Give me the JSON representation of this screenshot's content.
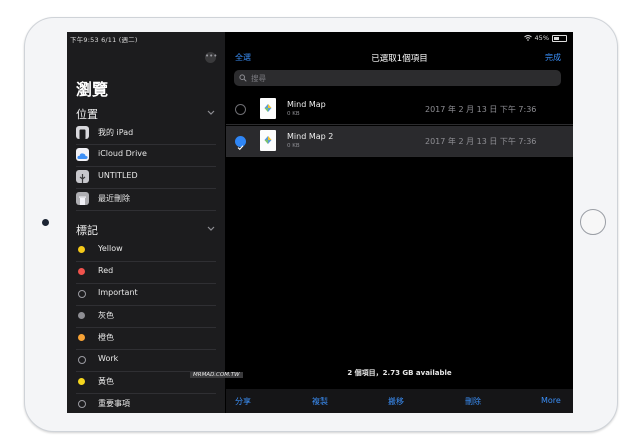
{
  "status_bar": {
    "time_date": "下午9:53  6/11 (週二)",
    "battery": "45%"
  },
  "sidebar": {
    "title": "瀏覽",
    "locations_header": "位置",
    "locations": [
      {
        "label": "我的 iPad",
        "icon": "ipad-icon"
      },
      {
        "label": "iCloud Drive",
        "icon": "icloud-icon"
      },
      {
        "label": "UNTITLED",
        "icon": "usb-drive-icon"
      },
      {
        "label": "最近刪除",
        "icon": "trash-icon"
      }
    ],
    "tags_header": "標記",
    "tags": [
      {
        "label": "Yellow",
        "color": "#f5c919"
      },
      {
        "label": "Red",
        "color": "#f0524c"
      },
      {
        "label": "Important",
        "color": ""
      },
      {
        "label": "灰色",
        "color": "#8e8e93"
      },
      {
        "label": "橙色",
        "color": "#f7a235"
      },
      {
        "label": "Work",
        "color": ""
      },
      {
        "label": "黃色",
        "color": "#f5d61e"
      },
      {
        "label": "重要事項",
        "color": ""
      }
    ]
  },
  "nav": {
    "select_all": "全選",
    "title": "已選取1個項目",
    "done": "完成"
  },
  "search": {
    "placeholder": "搜尋"
  },
  "files": [
    {
      "name": "Mind Map",
      "size": "0 KB",
      "date": "2017 年 2 月 13 日 下午 7:36",
      "selected": false
    },
    {
      "name": "Mind Map 2",
      "size": "0 KB",
      "date": "2017 年 2 月 13 日 下午 7:36",
      "selected": true
    }
  ],
  "footer": {
    "info": "2 個項目，2.73 GB available"
  },
  "toolbar": {
    "share": "分享",
    "copy": "複製",
    "move": "搬移",
    "delete": "刪除",
    "more": "More"
  },
  "watermark": "MRMAD.COM.TW",
  "colors": {
    "accent": "#3a8ef6",
    "selected_check": "#2f86f6"
  }
}
